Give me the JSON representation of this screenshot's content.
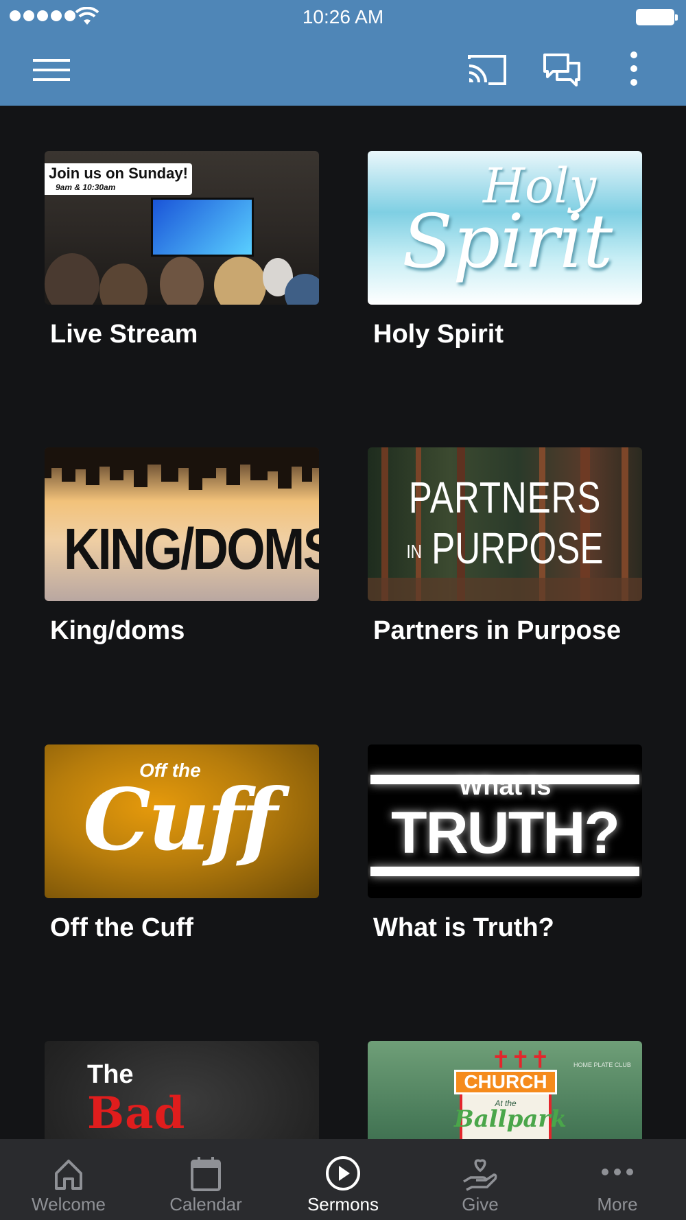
{
  "status_bar": {
    "time": "10:26 AM"
  },
  "app_bar": {
    "menu_icon": "hamburger-menu-icon",
    "cast_icon": "cast-icon",
    "chat_icon": "chat-bubbles-icon",
    "more_icon": "more-vertical-icon"
  },
  "colors": {
    "app_bar": "#4f86b7",
    "background": "#131416",
    "tab_bar": "#2a2b2e",
    "tab_inactive": "#8f9196",
    "tab_active": "#ffffff"
  },
  "cards": [
    {
      "title": "Live Stream",
      "thumb_banner": "Join us on Sunday!",
      "thumb_subbanner": "9am & 10:30am"
    },
    {
      "title": "Holy Spirit",
      "thumb_line1": "Holy",
      "thumb_line2": "Spirit"
    },
    {
      "title": "King/doms",
      "thumb_text": "KING/DOMS"
    },
    {
      "title": "Partners in Purpose",
      "thumb_line1": "PARTNERS",
      "thumb_small": "IN",
      "thumb_line2": "PURPOSE"
    },
    {
      "title": "Off the Cuff",
      "thumb_small": "Off the",
      "thumb_big": "Cuff"
    },
    {
      "title": "What is Truth?",
      "thumb_line1": "What is",
      "thumb_line2": "TRUTH?"
    },
    {
      "title": "",
      "thumb_line1": "The",
      "thumb_line2": "Bad Habits"
    },
    {
      "title": "",
      "thumb_church": "CHURCH",
      "thumb_at": "At the",
      "thumb_script": "Ballpark",
      "thumb_sign": "HOME PLATE CLUB"
    }
  ],
  "tabs": [
    {
      "label": "Welcome",
      "icon": "home-icon",
      "active": false
    },
    {
      "label": "Calendar",
      "icon": "calendar-icon",
      "active": false
    },
    {
      "label": "Sermons",
      "icon": "play-circle-icon",
      "active": true
    },
    {
      "label": "Give",
      "icon": "give-hand-heart-icon",
      "active": false
    },
    {
      "label": "More",
      "icon": "more-horizontal-icon",
      "active": false
    }
  ]
}
